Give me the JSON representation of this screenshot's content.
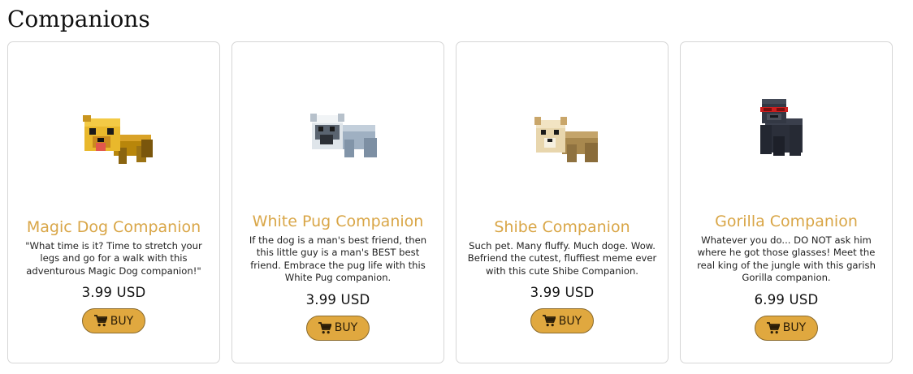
{
  "page": {
    "heading": "Companions"
  },
  "colors": {
    "accent": "#d9a647",
    "button_bg": "#e0a83f",
    "card_border": "#d6d6d6"
  },
  "products": [
    {
      "name": "Magic Dog Companion",
      "description": "\"What time is it? Time to stretch your legs and go for a walk with this adventurous Magic Dog companion!\"",
      "price": "3.99 USD",
      "buy_label": "BUY",
      "image": "magic-dog-pet-image"
    },
    {
      "name": "White Pug Companion",
      "description": "If the dog is a man's best friend, then this little guy is a man's BEST best friend. Embrace the pug life with this White Pug companion.",
      "price": "3.99 USD",
      "buy_label": "BUY",
      "image": "white-pug-pet-image"
    },
    {
      "name": "Shibe Companion",
      "description": "Such pet. Many fluffy. Much doge. Wow. Befriend the cutest, fluffiest meme ever with this cute Shibe Companion.",
      "price": "3.99 USD",
      "buy_label": "BUY",
      "image": "shibe-pet-image"
    },
    {
      "name": "Gorilla Companion",
      "description": "Whatever you do... DO NOT ask him where he got those glasses! Meet the real king of the jungle with this garish Gorilla companion.",
      "price": "6.99 USD",
      "buy_label": "BUY",
      "image": "gorilla-pet-image"
    }
  ]
}
